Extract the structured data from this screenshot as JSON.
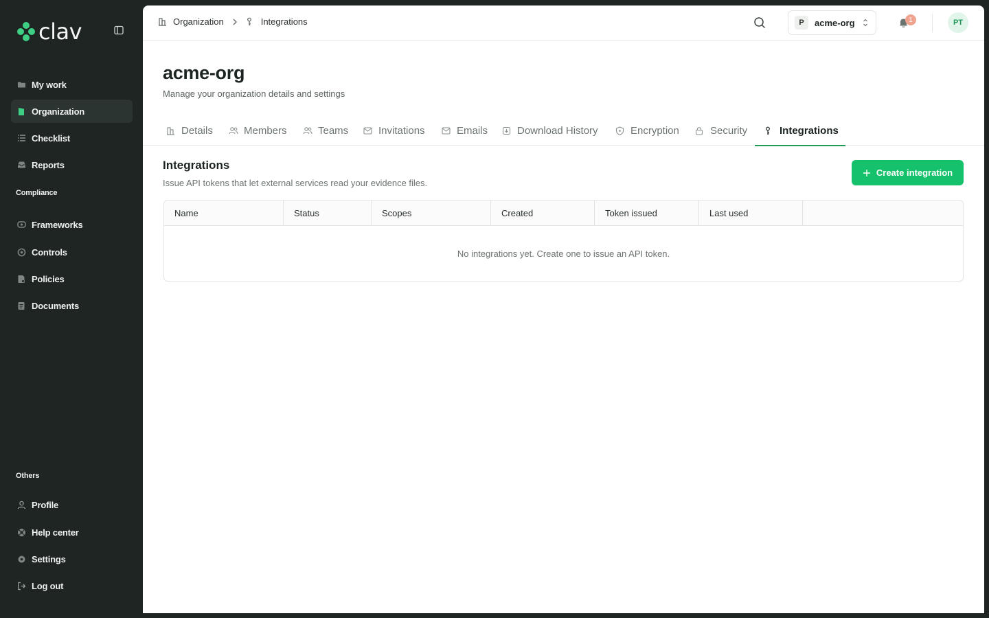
{
  "app": {
    "logo_text": "clav"
  },
  "sidebar": {
    "main_items": [
      {
        "label": "My work",
        "icon": "folder-icon"
      },
      {
        "label": "Organization",
        "icon": "building-icon",
        "active": true
      },
      {
        "label": "Checklist",
        "icon": "list-icon"
      },
      {
        "label": "Reports",
        "icon": "inbox-icon"
      }
    ],
    "compliance_label": "Compliance",
    "compliance_items": [
      {
        "label": "Frameworks",
        "icon": "framework-icon"
      },
      {
        "label": "Controls",
        "icon": "controls-icon"
      },
      {
        "label": "Policies",
        "icon": "policy-icon"
      },
      {
        "label": "Documents",
        "icon": "document-icon"
      }
    ],
    "others_label": "Others",
    "other_items": [
      {
        "label": "Profile",
        "icon": "user-icon"
      },
      {
        "label": "Help center",
        "icon": "help-icon"
      },
      {
        "label": "Settings",
        "icon": "gear-icon"
      },
      {
        "label": "Log out",
        "icon": "logout-icon"
      }
    ]
  },
  "topbar": {
    "breadcrumb": [
      {
        "label": "Organization",
        "icon": "building-icon"
      },
      {
        "label": "Integrations",
        "icon": "key-icon"
      }
    ],
    "org_badge": "P",
    "org_name": "acme-org",
    "notification_count": "1",
    "avatar_initials": "PT"
  },
  "page": {
    "title": "acme-org",
    "subtitle": "Manage your organization details and settings"
  },
  "tabs": [
    {
      "label": "Details",
      "icon": "building-icon"
    },
    {
      "label": "Members",
      "icon": "users-icon"
    },
    {
      "label": "Teams",
      "icon": "team-icon"
    },
    {
      "label": "Invitations",
      "icon": "mail-icon"
    },
    {
      "label": "Emails",
      "icon": "mail-icon"
    },
    {
      "label": "Download History",
      "icon": "download-icon"
    },
    {
      "label": "Encryption",
      "icon": "shield-icon"
    },
    {
      "label": "Security",
      "icon": "lock-icon"
    },
    {
      "label": "Integrations",
      "icon": "key-icon",
      "active": true
    }
  ],
  "integrations": {
    "title": "Integrations",
    "subtitle": "Issue API tokens that let external services read your evidence files.",
    "create_label": "Create integration",
    "columns": [
      "Name",
      "Status",
      "Scopes",
      "Created",
      "Token issued",
      "Last used"
    ],
    "empty_message": "No integrations yet. Create one to issue an API token."
  },
  "colors": {
    "sidebar_bg": "#1e2523",
    "accent": "#15c26b",
    "tab_underline": "#1e9b57",
    "badge": "#f0a48f"
  }
}
